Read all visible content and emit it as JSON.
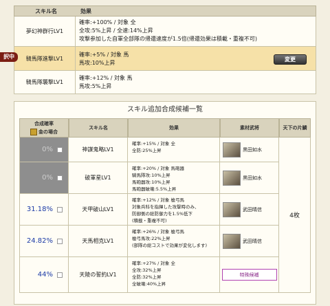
{
  "top_table": {
    "headers": {
      "name": "スキル名",
      "effect": "効果"
    },
    "skills": [
      {
        "name": "夢幻神群行LV1",
        "lines": [
          "確率:+100% / 対象 全",
          "全攻:5%上昇 / 全速:14%上昇",
          "攻撃参加した自軍全部隊の帰還速度が1.5倍(帰還効果は積載・重複不可)"
        ]
      },
      {
        "name": "騎馬隊進撃LV1",
        "lines": [
          "確率:+5% / 対象 馬",
          "馬攻:10%上昇"
        ],
        "selected": true
      },
      {
        "name": "騎馬隊襲撃LV1",
        "lines": [
          "確率:+12% / 対象 馬",
          "馬攻:5%上昇"
        ]
      }
    ],
    "selected_badge": "択中",
    "change_button": "変更"
  },
  "candidates": {
    "title": "スキル追加合成候補一覧",
    "headers": {
      "rate": "合成確率",
      "rate_sub": "金の場合",
      "name": "スキル名",
      "effect": "効果",
      "material": "素材武将",
      "limit": "天下の片鱗"
    },
    "rows": [
      {
        "rate": "0%",
        "disabled": true,
        "name": "神謀鬼略LV1",
        "effects": [
          "確率:+15% / 対象 全",
          "全防:25%上昇"
        ],
        "material": "黒田如水"
      },
      {
        "rate": "0%",
        "disabled": true,
        "name": "破軍星LV1",
        "effects": [
          "確率:+20% / 対象 馬砲器",
          "騎馬隊攻:10%上昇",
          "馬砲器攻:10%上昇",
          "馬砲器破壊:5.5%上昇"
        ],
        "material": "黒田如水"
      },
      {
        "rate": "31.18%",
        "disabled": false,
        "name": "天甲破山LV1",
        "effects": [
          "確率:+12% / 対象 槍弓馬",
          "対象兵科を指揮した攻撃時のみ、",
          "防御側の総防御力を1.5%低下",
          "(積載・重複不可)"
        ],
        "material": "武田晴信"
      },
      {
        "rate": "24.82%",
        "disabled": false,
        "name": "天馬相克LV1",
        "effects": [
          "確率:+26% / 対象 槍弓馬",
          "槍弓馬攻:22%上昇",
          "(部隊の総コストで効果が変化します)"
        ],
        "material": "武田晴信"
      },
      {
        "rate": "44%",
        "disabled": false,
        "name": "天陵の誓約LV1",
        "effects": [
          "確率:+27% / 対象 全",
          "全攻:32%上昇",
          "全防:32%上昇",
          "全破壊:40%上昇"
        ],
        "material": "特殊候補"
      }
    ],
    "limit_value": "4枚"
  },
  "colors": {
    "accent": "#7b1e14",
    "green": "#2e7d1d",
    "blue": "#1b3aa6",
    "selected_bg": "#f6e1a8"
  }
}
